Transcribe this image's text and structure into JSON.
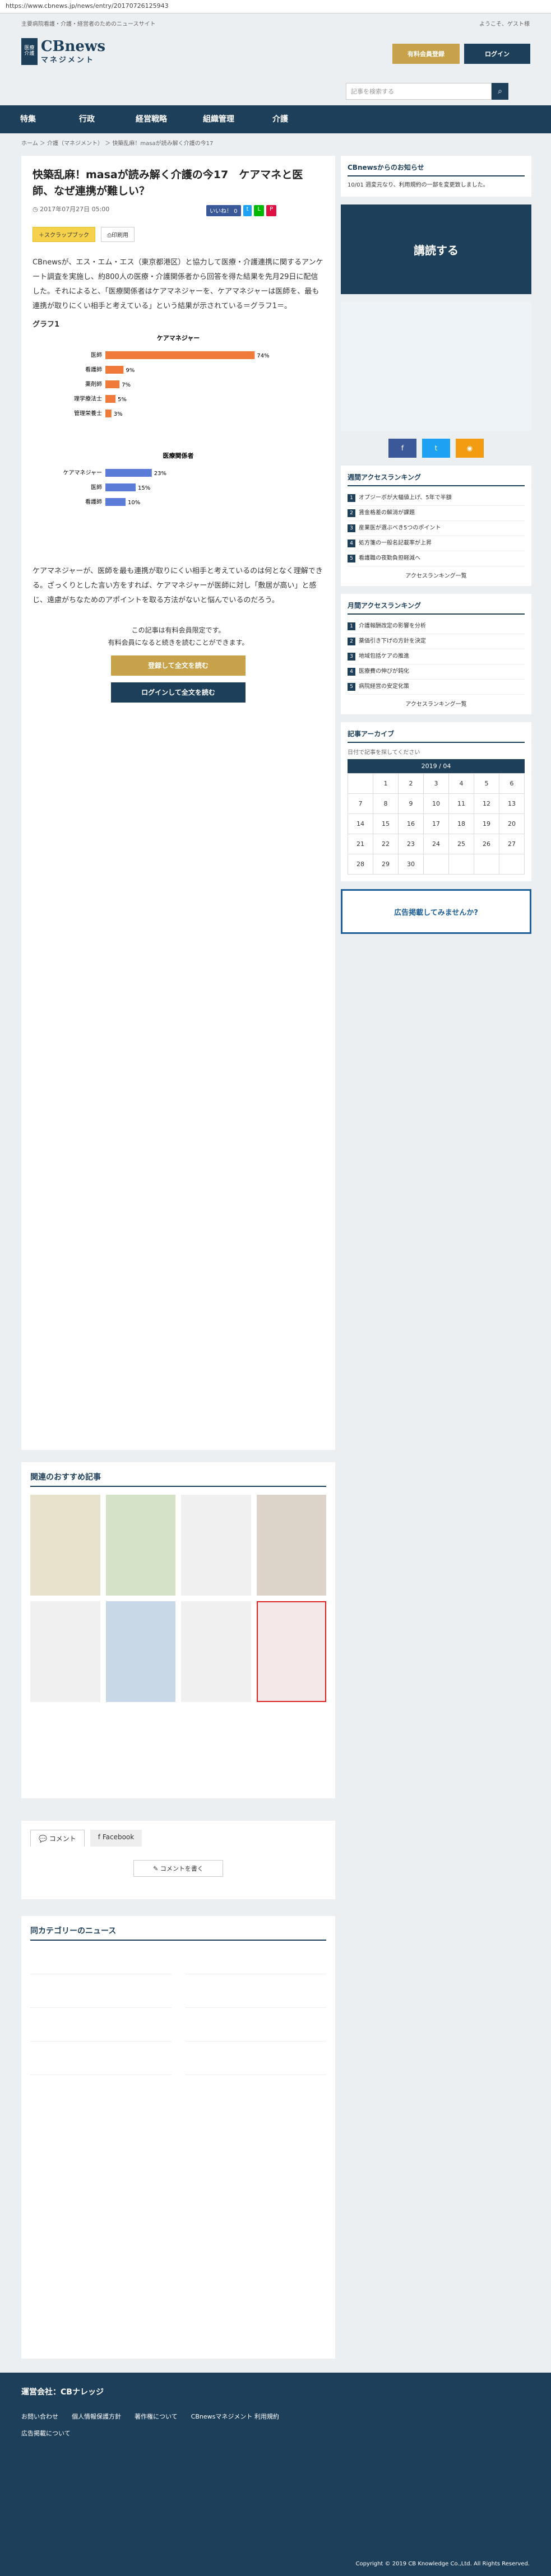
{
  "browser": {
    "url": "https://www.cbnews.jp/news/entry/20170726125943"
  },
  "header": {
    "tagline": "主要病院看護・介護・経営者のためのニュースサイト",
    "welcome": "ようこそ、ゲスト様",
    "logo_mark": "医療 介護",
    "logo_text": "CBnews",
    "logo_sub": "マネジメント",
    "btn_member": "有料会員登録",
    "btn_login": "ログイン",
    "search_placeholder": "記事を検索する"
  },
  "nav": [
    "特集",
    "行政",
    "経営戦略",
    "組織管理",
    "介護"
  ],
  "breadcrumb": "ホーム ＞ 介護（マネジメント） ＞ 快築乱麻！masaが読み解く介護の今17",
  "article": {
    "title": "快築乱麻！masaが読み解く介護の今17　ケアマネと医師、なぜ連携が難しい？",
    "date": "2017年07月27日 05:00",
    "share_like": "いいね！ 0",
    "tag_scrap": "スクラップブック",
    "tag_print": "印刷用",
    "paragraph": "CBnewsが、エス・エム・エス（東京都港区）と協力して医療・介護連携に関するアンケート調査を実施し、約800人の医療・介護関係者から回答を得た結果を先月29日に配信した。それによると、「医療関係者はケアマネジャーを、ケアマネジャーは医師を、最も連携が取りにくい相手と考えている」という結果が示されている＝グラフ1＝。",
    "chart_title": "グラフ1",
    "paragraph2": "ケアマネジャーが、医師を最も連携が取りにくい相手と考えているのは何となく理解できる。ざっくりとした言い方をすれば、ケアマネジャーが医師に対し「敷居が高い」と感じ、遠慮がちなためのアポイントを取る方法がないと悩んでいるのだろう。",
    "paywall_1": "この記事は有料会員限定です。",
    "paywall_2": "有料会員になると続きを読むことができます。",
    "btn_register": "登録して全文を読む",
    "btn_login_read": "ログインして全文を読む"
  },
  "chart_data": {
    "type": "bar",
    "title": "ケアマネジャー",
    "categories": [
      "医師",
      "看護師",
      "薬剤師",
      "理学療法士",
      "管理栄養士"
    ],
    "values": [
      74,
      9,
      7,
      5,
      3
    ],
    "ylabel": "",
    "ylim": [
      0,
      100
    ]
  },
  "chart_data_2": {
    "title": "医療関係者",
    "categories": [
      "ケアマネジャー",
      "医師",
      "看護師"
    ],
    "values": [
      23,
      15,
      10
    ]
  },
  "related_title": "関連のおすすめ記事",
  "comments": {
    "tab1": "コメント",
    "tab2": "Facebook",
    "btn": "コメントを書く"
  },
  "news_title": "同カテゴリーのニュース",
  "sidebar": {
    "notice_title": "CBnewsからのお知らせ",
    "notice": "10/01 週変元なり、利用規約の一部を変更致しました。",
    "app_title": "講読する",
    "ranking_week": "週間アクセスランキング",
    "ranking_month": "月間アクセスランキング",
    "ranking_more": "アクセスランキング一覧",
    "archive": "記事アーカイブ",
    "archive_sub": "日付で記事を探してください",
    "month": "2019 / 04",
    "ad": "広告掲載してみませんか?",
    "week_items": [
      "オプジーボが大幅値上げ、5年で半額",
      "賃金格差の解消が課題",
      "産業医が選ぶべき5つのポイント",
      "処方箋の一般名記載率が上昇",
      "看護職の夜勤負担軽減へ"
    ],
    "month_items": [
      "介護報酬改定の影響を分析",
      "薬価引き下げの方針を決定",
      "地域包括ケアの推進",
      "医療費の伸びが鈍化",
      "病院経営の安定化策"
    ]
  },
  "footer": {
    "company": "運営会社：CBナレッジ",
    "links": [
      "お問い合わせ",
      "個人情報保護方針",
      "著作権について",
      "CBnewsマネジメント 利用規約",
      "広告掲載について"
    ],
    "copyright": "Copyright © 2019 CB Knowledge Co.,Ltd. All Rights Reserved."
  }
}
